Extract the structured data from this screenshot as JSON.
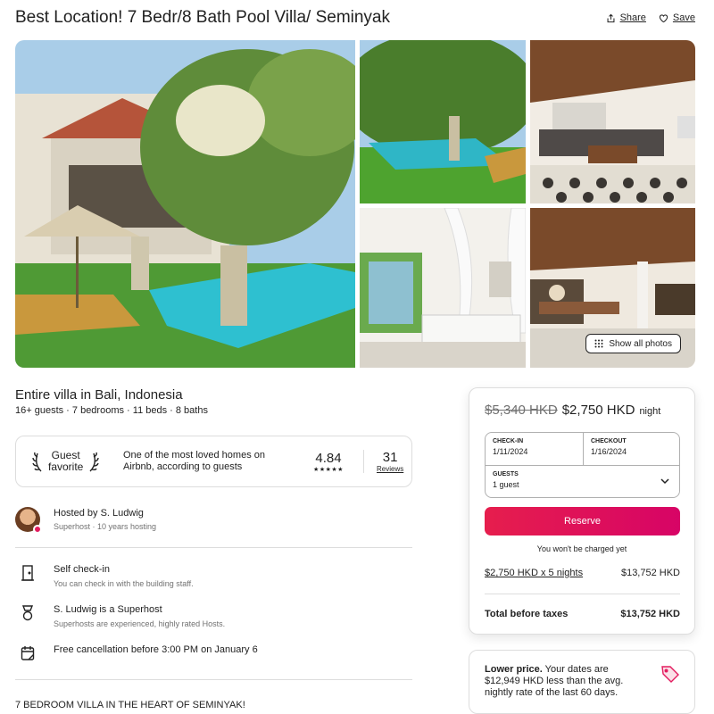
{
  "listing": {
    "title": "Best Location! 7 Bedr/8 Bath Pool Villa/ Seminyak",
    "share_label": "Share",
    "save_label": "Save",
    "show_all_photos_label": "Show all photos",
    "place_title": "Entire villa in Bali, Indonesia",
    "place_summary": "16+ guests · 7 bedrooms · 11 beds · 8 baths"
  },
  "guest_favorite": {
    "badge_line1": "Guest",
    "badge_line2": "favorite",
    "description": "One of the most loved homes on Airbnb, according to guests",
    "rating": "4.84",
    "stars": "★★★★★",
    "reviews_count": "31",
    "reviews_label": "Reviews"
  },
  "host": {
    "name": "Hosted by S. Ludwig",
    "subtitle": "Superhost · 10 years hosting"
  },
  "highlights": [
    {
      "title": "Self check-in",
      "subtitle": "You can check in with the building staff.",
      "icon": "door-icon"
    },
    {
      "title": "S. Ludwig is a Superhost",
      "subtitle": "Superhosts are experienced, highly rated Hosts.",
      "icon": "superhost-medal-icon"
    },
    {
      "title": "Free cancellation before 3:00 PM on January 6",
      "subtitle": "",
      "icon": "calendar-icon"
    }
  ],
  "description_start": "7 BEDROOM VILLA IN THE HEART OF SEMINYAK!",
  "booking": {
    "old_price": "$5,340 HKD",
    "new_price": "$2,750 HKD",
    "per": "night",
    "checkin_label": "CHECK-IN",
    "checkin_value": "1/11/2024",
    "checkout_label": "CHECKOUT",
    "checkout_value": "1/16/2024",
    "guests_label": "GUESTS",
    "guests_value": "1 guest",
    "reserve_label": "Reserve",
    "no_charge_note": "You won't be charged yet",
    "nights_calc": "$2,750 HKD x 5 nights",
    "nights_total": "$13,752 HKD",
    "total_label": "Total before taxes",
    "total_value": "$13,752 HKD"
  },
  "lower_price": {
    "heading": "Lower price.",
    "body": "Your dates are $12,949 HKD less than the avg. nightly rate of the last 60 days."
  },
  "colors": {
    "accent": "#e61e4d",
    "accent_end": "#d70466",
    "muted_text": "#717171",
    "border": "#dddddd"
  }
}
